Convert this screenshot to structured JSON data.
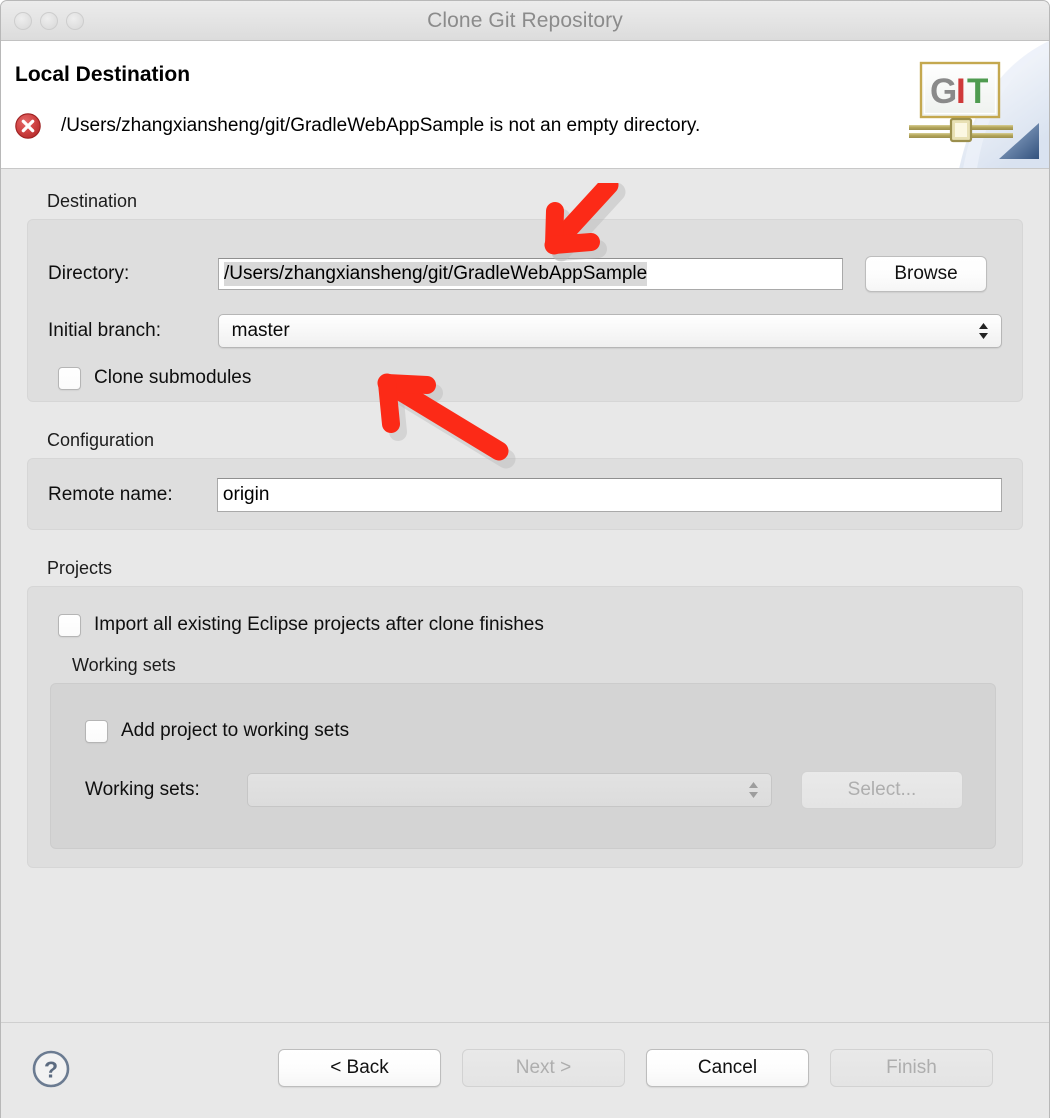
{
  "window": {
    "title": "Clone Git Repository",
    "traffic_lights": [
      "close-button",
      "minimize-button",
      "zoom-button"
    ]
  },
  "banner": {
    "title": "Local Destination",
    "status_icon": "error-icon",
    "message": "/Users/zhangxiansheng/git/GradleWebAppSample is not an empty directory.",
    "logo": {
      "name": "git-logo",
      "letters": [
        "G",
        "I",
        "T"
      ],
      "letter_colors": [
        "#8a8a8a",
        "#cf3a3a",
        "#4f9b50"
      ]
    }
  },
  "destination": {
    "group_label": "Destination",
    "directory_label": "Directory:",
    "directory_value": "/Users/zhangxiansheng/git/GradleWebAppSample",
    "browse_label": "Browse",
    "branch_label": "Initial branch:",
    "branch_value": "master",
    "clone_submodules_label": "Clone submodules",
    "clone_submodules_checked": false
  },
  "configuration": {
    "group_label": "Configuration",
    "remote_name_label": "Remote name:",
    "remote_name_value": "origin"
  },
  "projects": {
    "group_label": "Projects",
    "import_label": "Import all existing Eclipse projects after clone finishes",
    "import_checked": false,
    "working_sets": {
      "group_label": "Working sets",
      "add_label": "Add project to working sets",
      "add_checked": false,
      "combo_label": "Working sets:",
      "combo_value": "",
      "combo_disabled": true,
      "select_label": "Select...",
      "select_disabled": true
    }
  },
  "footer": {
    "help_icon": "help-question-icon",
    "buttons": [
      {
        "label": "< Back",
        "disabled": false
      },
      {
        "label": "Next >",
        "disabled": true
      },
      {
        "label": "Cancel",
        "disabled": false
      },
      {
        "label": "Finish",
        "disabled": true
      }
    ]
  },
  "annotations": {
    "arrow_color": "#fc2a17",
    "arrow_1": "red-arrow-pointing-to-directory-field",
    "arrow_2": "red-arrow-pointing-to-initial-branch-combo"
  }
}
